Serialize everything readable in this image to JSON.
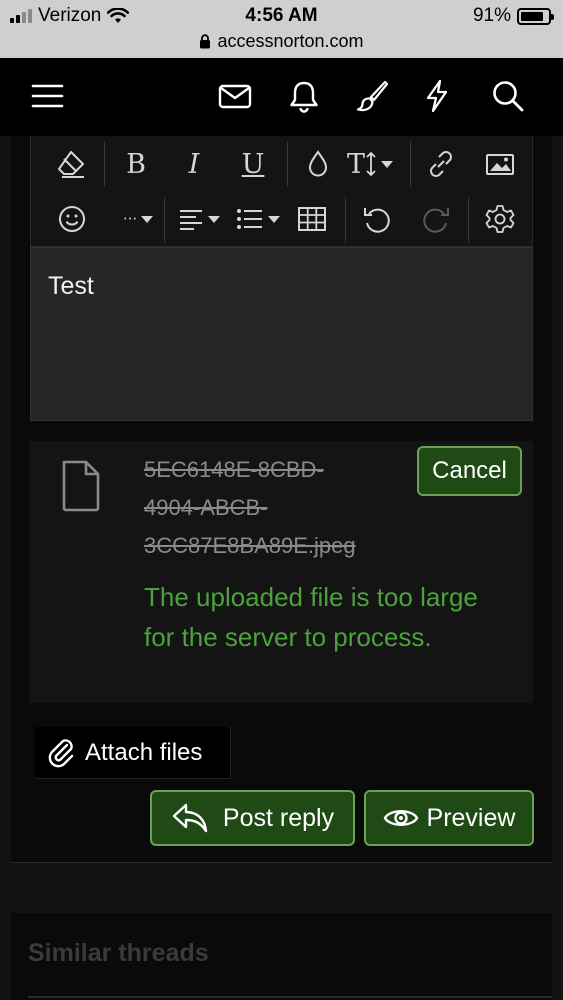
{
  "status": {
    "carrier": "Verizon",
    "time": "4:56 AM",
    "battery": "91%",
    "battery_level": 0.91
  },
  "browser": {
    "url": "accessnorton.com"
  },
  "nav": {
    "icons": [
      "menu-icon",
      "mail-icon",
      "bell-icon",
      "brush-icon",
      "bolt-icon",
      "search-icon"
    ]
  },
  "toolbar": {
    "bold_label": "B",
    "italic_label": "I",
    "underline_label": "U",
    "text_size_label": "T",
    "more_label": "···"
  },
  "editor": {
    "text": "Test"
  },
  "upload": {
    "file_name": "5EC6148E-8CBD-4904-ABCB-3CC87E8BA89E.jpeg",
    "file_name_lines": [
      "5EC6148E-8CBD-",
      "4904-ABCB-",
      "3CC87E8BA89E.jpeg"
    ],
    "cancel_label": "Cancel",
    "error": "The uploaded file is too large for the server to process.",
    "error_color": "#4aa33a"
  },
  "attach": {
    "label": "Attach files"
  },
  "actions": {
    "post_reply_label": "Post reply",
    "preview_label": "Preview",
    "button_color": "#1f4a16",
    "button_border": "#6aa152"
  },
  "similar": {
    "title": "Similar threads"
  }
}
